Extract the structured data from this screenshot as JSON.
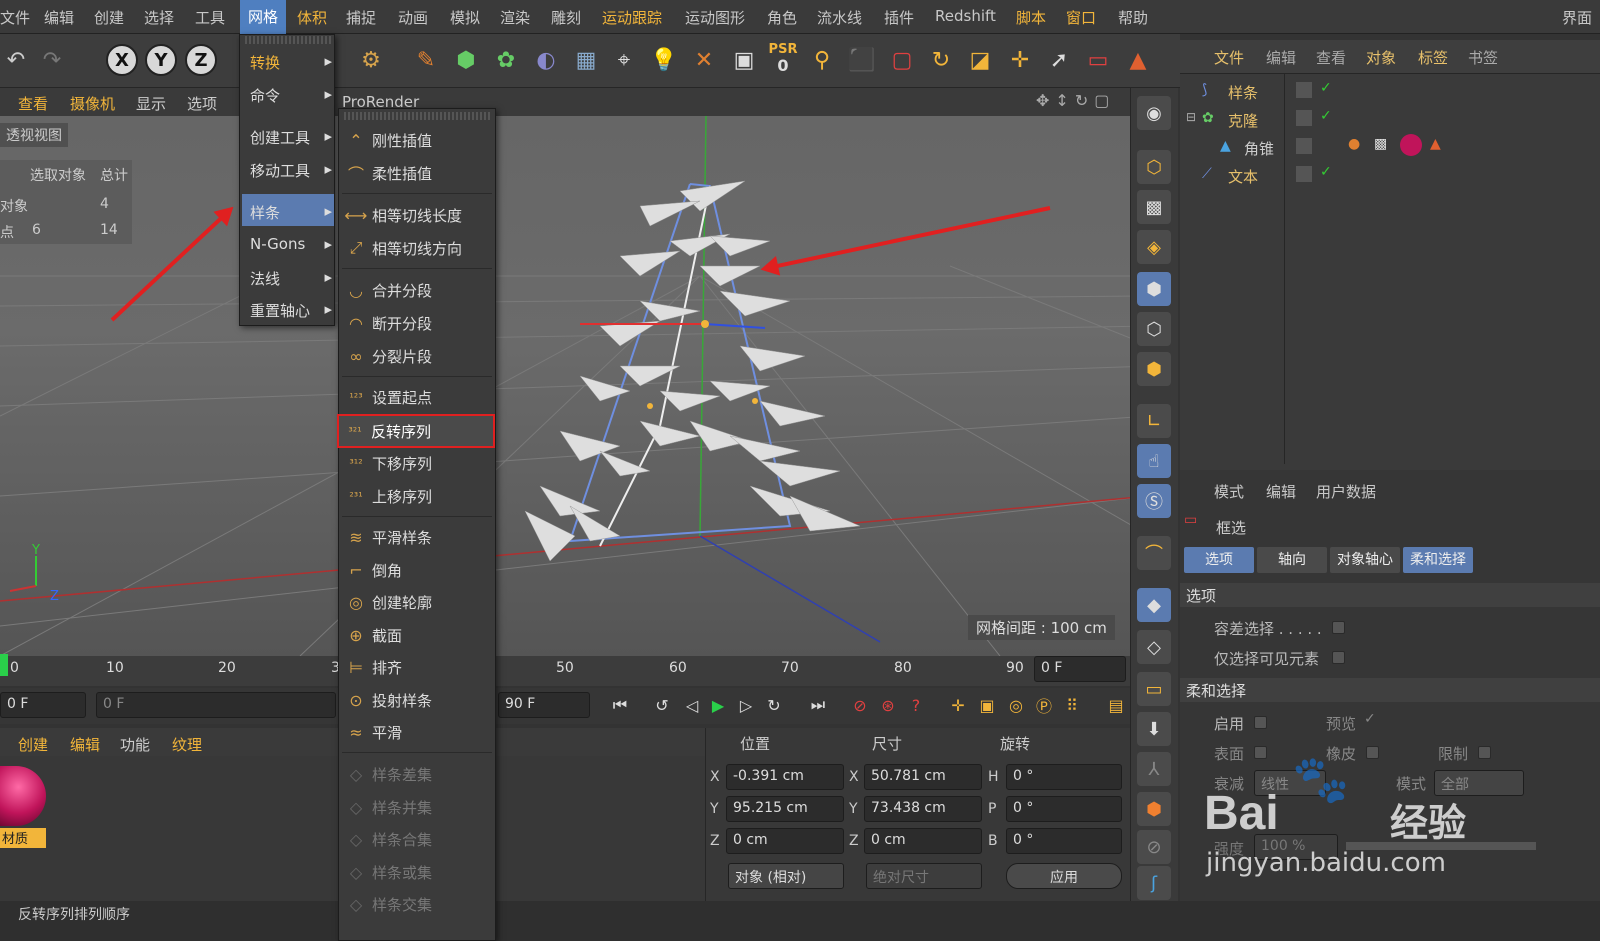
{
  "menubar": {
    "items": [
      "文件",
      "编辑",
      "创建",
      "选择",
      "工具",
      "网格",
      "体积",
      "捕捉",
      "动画",
      "模拟",
      "渲染",
      "雕刻",
      "运动跟踪",
      "运动图形",
      "角色",
      "流水线",
      "插件",
      "Redshift",
      "脚本",
      "窗口",
      "帮助",
      "界面"
    ],
    "active": "网格"
  },
  "toolbar": {
    "axis_x": "X",
    "axis_y": "Y",
    "axis_z": "Z",
    "psr_label": "PSR",
    "psr_value": "0"
  },
  "viewport": {
    "menus": [
      "查看",
      "摄像机",
      "显示",
      "选项"
    ],
    "renderer": "ProRender",
    "view_name": "透视视图",
    "grid_spacing": "网格间距 : 100 cm"
  },
  "stats": {
    "header": [
      "选取对象",
      "总计"
    ],
    "rows": [
      [
        "对象",
        "",
        "4"
      ],
      [
        "点",
        "6",
        "14"
      ]
    ]
  },
  "menu_mesh": {
    "items": [
      {
        "label": "转换",
        "sub": true
      },
      {
        "label": "命令",
        "sub": true
      },
      {
        "label": "创建工具",
        "sub": true
      },
      {
        "label": "移动工具",
        "sub": true
      },
      {
        "label": "样条",
        "sub": true,
        "active": true
      },
      {
        "label": "N-Gons",
        "sub": true
      },
      {
        "label": "法线",
        "sub": true
      },
      {
        "label": "重置轴心",
        "sub": true
      }
    ]
  },
  "menu_spline": {
    "items": [
      {
        "label": "刚性插值",
        "icon": "rigid-interp-icon",
        "glyph": "⌃"
      },
      {
        "label": "柔性插值",
        "icon": "soft-interp-icon",
        "glyph": "⌒"
      },
      {
        "label": "相等切线长度",
        "icon": "equal-tangent-length-icon",
        "glyph": "⟷"
      },
      {
        "label": "相等切线方向",
        "icon": "equal-tangent-dir-icon",
        "glyph": "⤢"
      },
      {
        "label": "合并分段",
        "icon": "join-segment-icon",
        "glyph": "◡"
      },
      {
        "label": "断开分段",
        "icon": "break-segment-icon",
        "glyph": "◠"
      },
      {
        "label": "分裂片段",
        "icon": "explode-segments-icon",
        "glyph": "∞"
      },
      {
        "label": "设置起点",
        "icon": "set-first-point-icon",
        "glyph": "¹²³"
      },
      {
        "label": "反转序列",
        "icon": "reverse-sequence-icon",
        "glyph": "³²¹",
        "highlight": true
      },
      {
        "label": "下移序列",
        "icon": "move-down-sequence-icon",
        "glyph": "³¹²"
      },
      {
        "label": "上移序列",
        "icon": "move-up-sequence-icon",
        "glyph": "²³¹"
      },
      {
        "label": "平滑样条",
        "icon": "smooth-spline-icon",
        "glyph": "≋"
      },
      {
        "label": "倒角",
        "icon": "chamfer-icon",
        "glyph": "⌐"
      },
      {
        "label": "创建轮廓",
        "icon": "create-outline-icon",
        "glyph": "◎"
      },
      {
        "label": "截面",
        "icon": "cross-section-icon",
        "glyph": "⊕"
      },
      {
        "label": "排齐",
        "icon": "line-up-icon",
        "glyph": "⊨"
      },
      {
        "label": "投射样条",
        "icon": "project-spline-icon",
        "glyph": "⊙"
      },
      {
        "label": "平滑",
        "icon": "smooth-icon",
        "glyph": "≈"
      },
      {
        "label": "样条差集",
        "icon": "spline-subtract-icon",
        "glyph": "◇",
        "disabled": true
      },
      {
        "label": "样条并集",
        "icon": "spline-union-icon",
        "glyph": "◇",
        "disabled": true
      },
      {
        "label": "样条合集",
        "icon": "spline-and-icon",
        "glyph": "◇",
        "disabled": true
      },
      {
        "label": "样条或集",
        "icon": "spline-or-icon",
        "glyph": "◇",
        "disabled": true
      },
      {
        "label": "样条交集",
        "icon": "spline-intersect-icon",
        "glyph": "◇",
        "disabled": true
      }
    ]
  },
  "timeline": {
    "ticks": [
      "0",
      "10",
      "20",
      "3",
      "50",
      "60",
      "70",
      "80",
      "90"
    ],
    "end_frame": "0 F"
  },
  "transport": {
    "current": "0 F",
    "slider": "0 F",
    "end": "90 F"
  },
  "materials": {
    "tabs": [
      "创建",
      "编辑",
      "功能",
      "纹理"
    ],
    "material_name": "材质",
    "material_color": "#c0145a"
  },
  "coords": {
    "headers": [
      "位置",
      "尺寸",
      "旋转"
    ],
    "rows": [
      {
        "axis": "X",
        "pos": "-0.391 cm",
        "saxis": "X",
        "size": "50.781 cm",
        "raxis": "H",
        "rot": "0 °"
      },
      {
        "axis": "Y",
        "pos": "95.215 cm",
        "saxis": "Y",
        "size": "73.438 cm",
        "raxis": "P",
        "rot": "0 °"
      },
      {
        "axis": "Z",
        "pos": "0 cm",
        "saxis": "Z",
        "size": "0 cm",
        "raxis": "B",
        "rot": "0 °"
      }
    ],
    "mode": "对象 (相对)",
    "size_mode": "绝对尺寸",
    "apply": "应用"
  },
  "objects": {
    "menu": [
      "文件",
      "编辑",
      "查看",
      "对象",
      "标签",
      "书签"
    ],
    "tree": [
      {
        "name": "样条",
        "indent": 0,
        "icon": "spline-icon"
      },
      {
        "name": "克隆",
        "indent": 0,
        "icon": "cloner-icon"
      },
      {
        "name": "角锥",
        "indent": 1,
        "icon": "pyramid-icon"
      },
      {
        "name": "文本",
        "indent": 1,
        "icon": "text-spline-icon"
      }
    ]
  },
  "attributes": {
    "menu": [
      "模式",
      "编辑",
      "用户数据"
    ],
    "tool": "框选",
    "tabs": [
      "选项",
      "轴向",
      "对象轴心",
      "柔和选择"
    ],
    "section_options": "选项",
    "opt1": "容差选择 . . . . .",
    "opt2": "仅选择可见元素",
    "section_soft": "柔和选择",
    "enable": "启用",
    "preview": "预览",
    "surface": "表面",
    "rubber": "橡皮",
    "restrict": "限制",
    "falloff": "衰减",
    "falloff_value": "线性",
    "mode_label": "模式",
    "mode_value": "全部",
    "strength": "强度",
    "strength_value": "100 %"
  },
  "status": "反转序列排列顺序",
  "watermark": {
    "brand": "Bai",
    "brand2": "经验",
    "url": "jingyan.baidu.com"
  },
  "colors": {
    "accent": "#f2b53a",
    "highlight_box": "#e02020",
    "menu_active": "#4f7fc0"
  }
}
